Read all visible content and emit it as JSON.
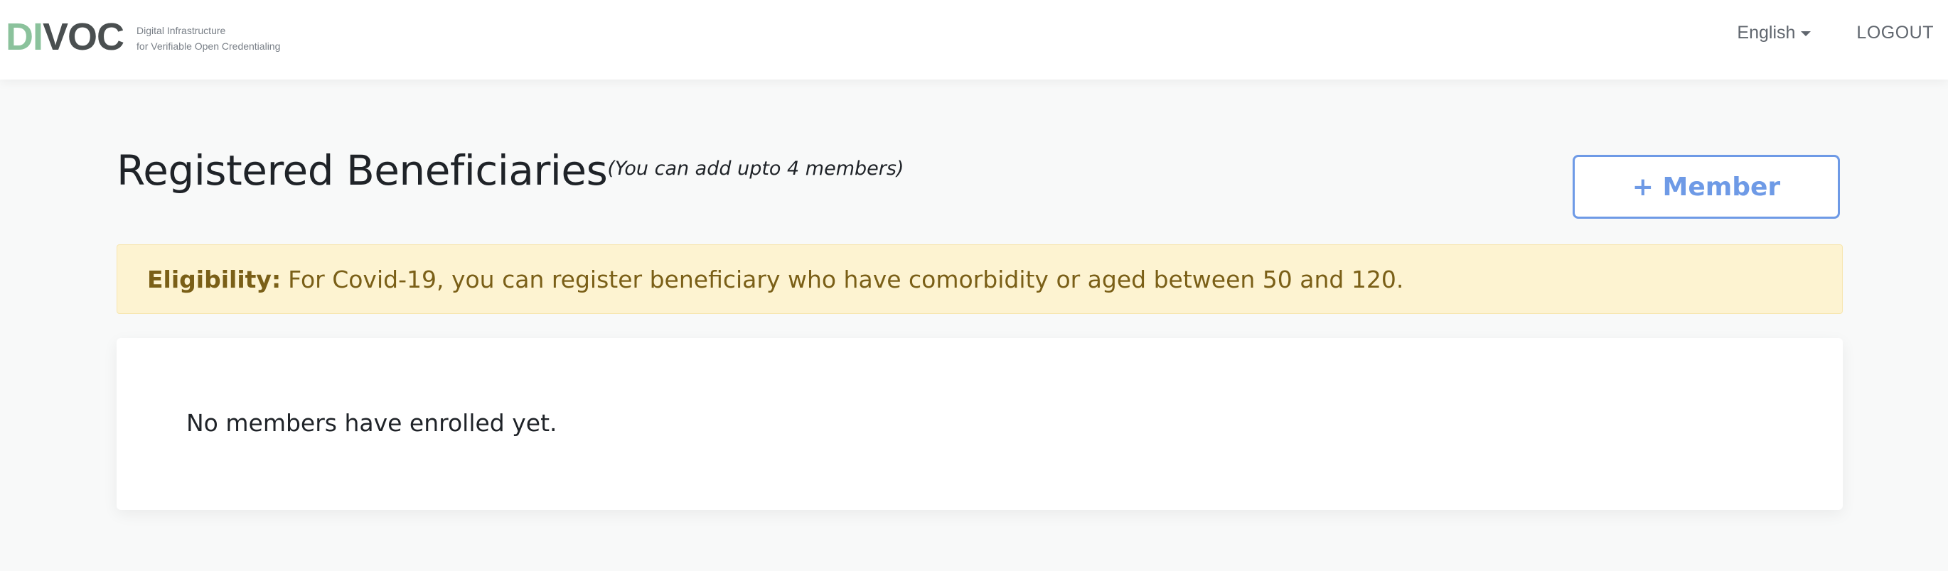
{
  "header": {
    "logo": {
      "mark_part1": "DI",
      "mark_part2": "VOC",
      "tagline_line1": "Digital Infrastructure",
      "tagline_line2": "for Verifiable Open Credentialing"
    },
    "language_label": "English",
    "logout_label": "LOGOUT"
  },
  "main": {
    "title": "Registered Beneficiaries",
    "title_note": "(You can add upto 4 members)",
    "add_member_label": "+ Member",
    "eligibility": {
      "label": "Eligibility:",
      "text": "For Covid-19, you can register beneficiary who have comorbidity or aged between 50 and 120."
    },
    "members": {
      "empty_message": "No members have enrolled yet."
    }
  },
  "colors": {
    "brand_green": "#8bc29c",
    "brand_dark": "#4a4f50",
    "accent_blue": "#6e9ae6",
    "alert_bg": "#fdf3d1",
    "alert_text": "#7a5f17"
  },
  "icons": {
    "language_dropdown": "caret-down-icon"
  }
}
